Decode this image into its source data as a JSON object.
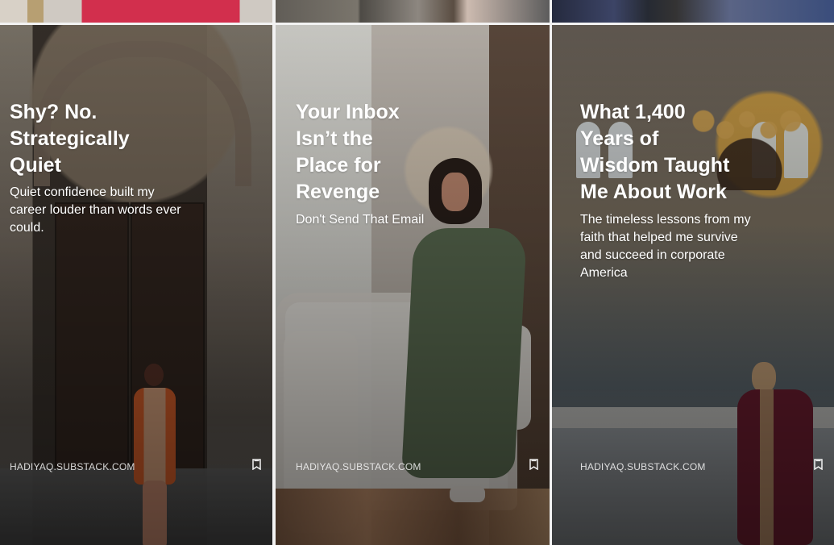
{
  "posts": [
    {
      "title": "Shy? No.\nStrategically\nQuiet",
      "subtitle": "Quiet confidence built my\ncareer louder than words ever\ncould.",
      "domain": "HADIYAQ.SUBSTACK.COM",
      "bookmark_icon": "bookmark-icon"
    },
    {
      "title": "Your Inbox\nIsn’t the\nPlace for\nRevenge",
      "subtitle": "Don't Send That Email",
      "domain": "HADIYAQ.SUBSTACK.COM",
      "bookmark_icon": "bookmark-icon"
    },
    {
      "title": "What 1,400\nYears of\nWisdom Taught\nMe About Work",
      "subtitle": "The timeless lessons from my\nfaith that helped me survive\nand succeed in corporate\nAmerica",
      "domain": "HADIYAQ.SUBSTACK.COM",
      "bookmark_icon": "bookmark-icon"
    }
  ],
  "colors": {
    "background": "#f2f2f2",
    "text": "#ffffff",
    "domain": "#f5f5f5"
  }
}
